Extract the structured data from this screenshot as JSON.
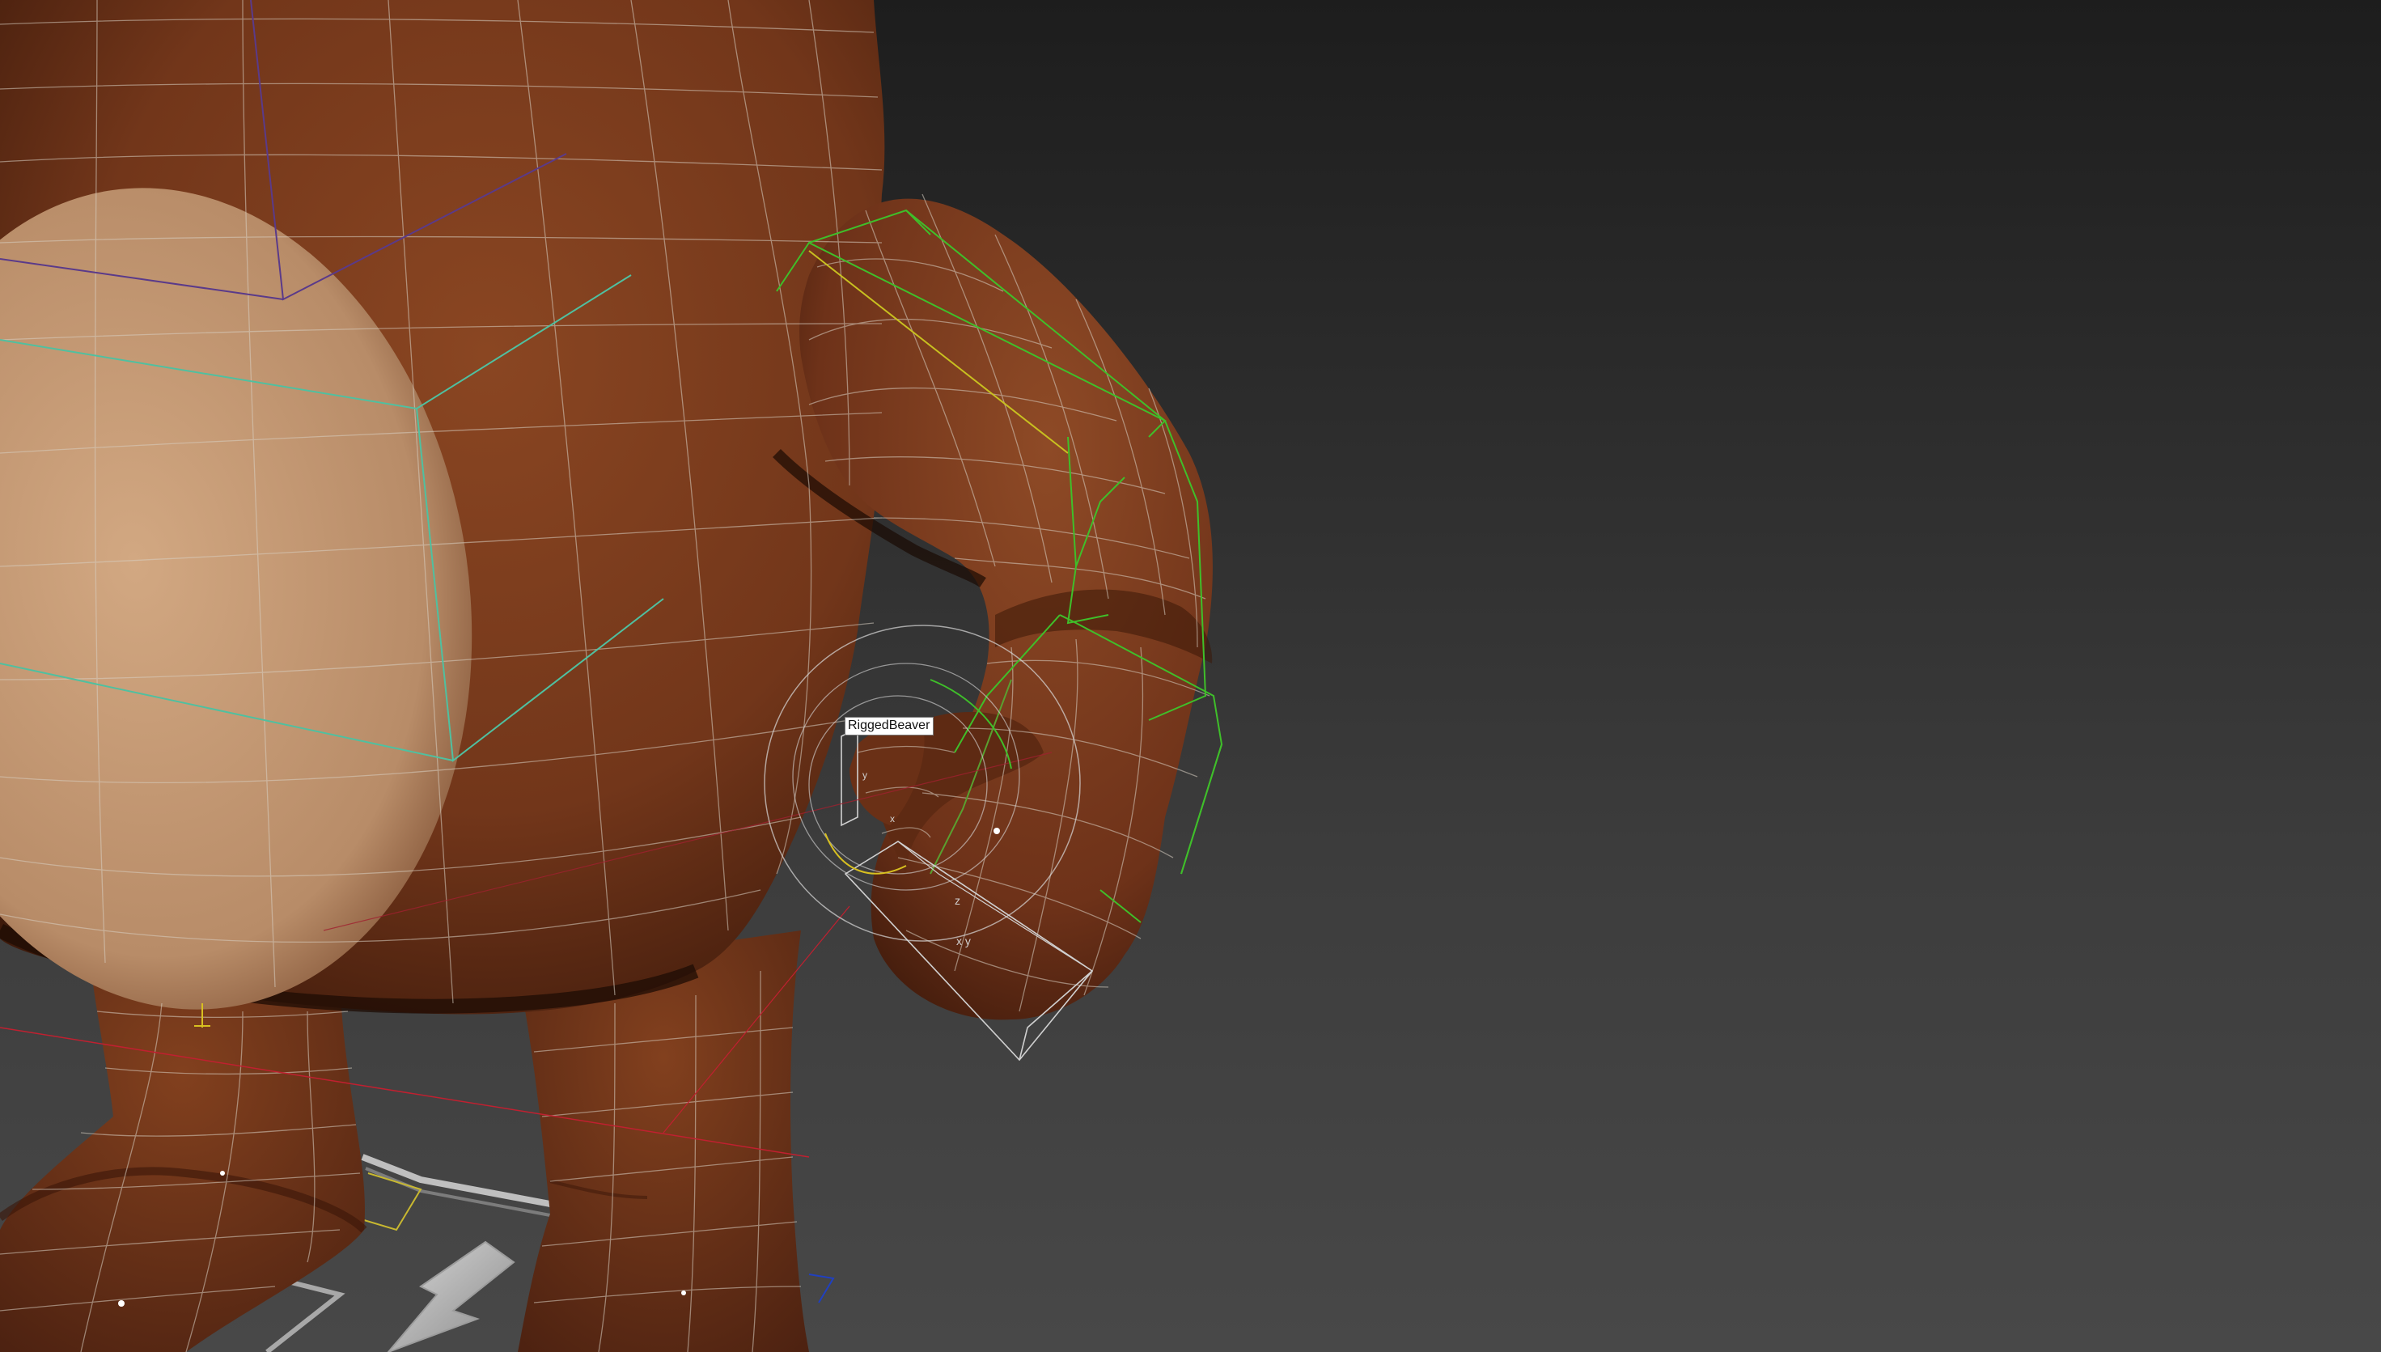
{
  "app": "3D viewport",
  "viewport": {
    "shading": "Shaded + Edged Faces",
    "background_top": "#1d1d1d",
    "background_bottom": "#484848"
  },
  "colors": {
    "fur": "#7a3c1c",
    "fur_dark": "#4a2010",
    "belly": "#c89b76",
    "wire": "#d8cfc2",
    "bone_green": "#3fbf2a",
    "bone_teal": "#4fc0a0",
    "bone_purple": "#5a3a8a",
    "bone_gray": "#d0d0d0",
    "axis_red": "#c02030",
    "gizmo_yellow": "#d8c020",
    "helper_blue": "#2040c0",
    "grid_white": "#e0e0e0"
  },
  "tooltip": {
    "object_name": "RiggedBeaver"
  },
  "icons": {
    "pivot": "pivot-gizmo-icon",
    "arrow": "move-arrow-icon"
  }
}
